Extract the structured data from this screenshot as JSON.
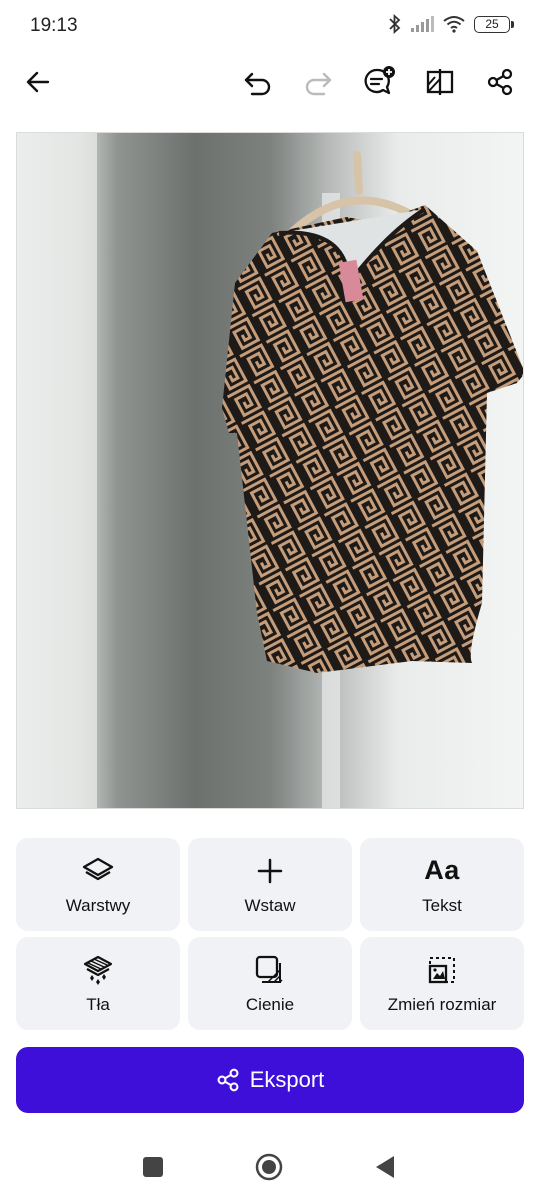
{
  "status_bar": {
    "time": "19:13",
    "battery": "25",
    "icons": [
      "bluetooth-icon",
      "signal-icon",
      "wifi-icon",
      "battery-icon"
    ]
  },
  "toolbar": {
    "icons": [
      "back-arrow-icon",
      "undo-icon",
      "redo-icon",
      "comment-add-icon",
      "compare-icon",
      "share-icon"
    ]
  },
  "canvas": {
    "image": "photo-of-patterned-blouse-on-hanger"
  },
  "tools": [
    {
      "label": "Warstwy",
      "icon": "layers-icon"
    },
    {
      "label": "Wstaw",
      "icon": "plus-icon"
    },
    {
      "label": "Tekst",
      "icon": "text-icon",
      "glyph": "Aa"
    },
    {
      "label": "Tła",
      "icon": "backgrounds-icon"
    },
    {
      "label": "Cienie",
      "icon": "shadow-icon"
    },
    {
      "label": "Zmień rozmiar",
      "icon": "resize-icon"
    }
  ],
  "export": {
    "label": "Eksport",
    "icon": "share-icon"
  },
  "colors": {
    "accent": "#3d0fd8",
    "tool_bg": "#f1f2f5"
  },
  "nav": {
    "icons": [
      "recents-icon",
      "home-icon",
      "back-icon"
    ]
  }
}
